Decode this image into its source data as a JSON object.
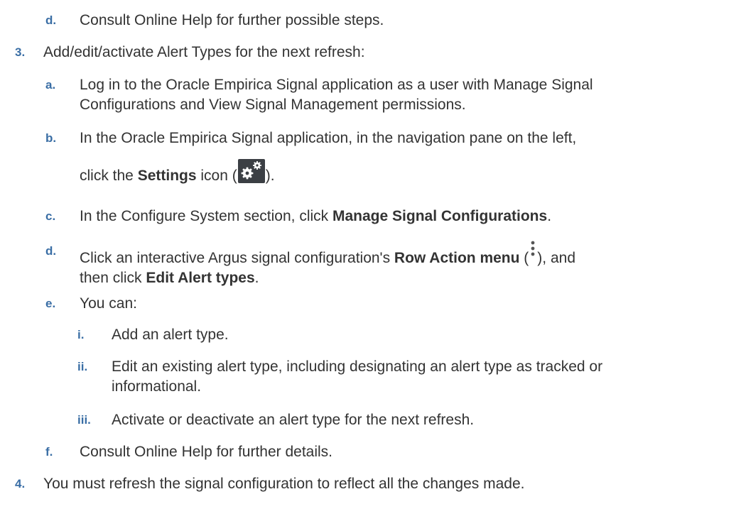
{
  "steps": {
    "step2d": {
      "marker": "d.",
      "text": "Consult Online Help for further possible steps."
    },
    "step3": {
      "marker": "3.",
      "text": "Add/edit/activate Alert Types for the next refresh:"
    },
    "step3a": {
      "marker": "a.",
      "line1": "Log in to the Oracle Empirica Signal application as a user with Manage Signal",
      "line2": "Configurations and View Signal Management permissions."
    },
    "step3b": {
      "marker": "b.",
      "line1": "In the Oracle Empirica Signal application, in the navigation pane on the left,",
      "pre": "click the ",
      "bold": "Settings",
      "mid": " icon (",
      "post": ").",
      "icon": "settings-gear-icon"
    },
    "step3c": {
      "marker": "c.",
      "pre": "In the Configure System section, click ",
      "bold": "Manage Signal Configurations",
      "post": "."
    },
    "step3d": {
      "marker": "d.",
      "pre": "Click an interactive Argus signal configuration's ",
      "bold": "Row Action menu",
      "mid": " (",
      "post": "), and",
      "line2pre": "then click ",
      "line2bold": "Edit Alert types",
      "line2post": ".",
      "icon": "kebab-menu-icon"
    },
    "step3e": {
      "marker": "e.",
      "text": "You can:"
    },
    "step3e_i": {
      "marker": "i.",
      "text": "Add an alert type."
    },
    "step3e_ii": {
      "marker": "ii.",
      "line1": "Edit an existing alert type, including designating an alert type as tracked or",
      "line2": "informational."
    },
    "step3e_iii": {
      "marker": "iii.",
      "text": "Activate or deactivate an alert type for the next refresh."
    },
    "step3f": {
      "marker": "f.",
      "text": "Consult Online Help for further details."
    },
    "step4": {
      "marker": "4.",
      "text": "You must refresh the signal configuration to reflect all the changes made."
    }
  }
}
